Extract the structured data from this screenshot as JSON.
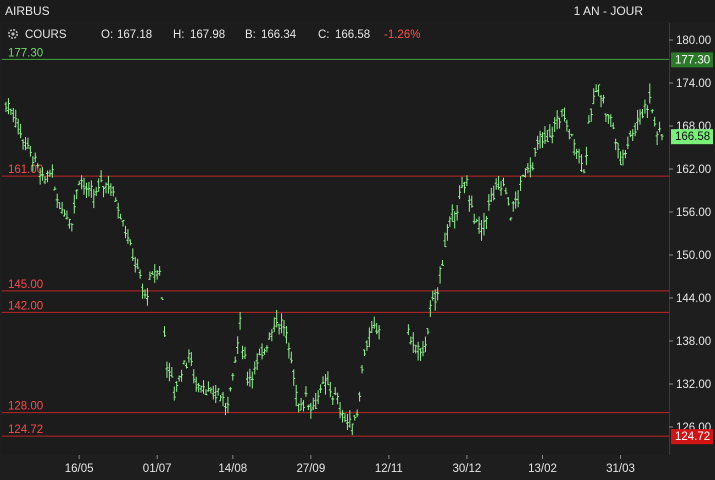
{
  "header": {
    "symbol": "AIRBUS",
    "period": "1 AN - JOUR"
  },
  "info_bar": {
    "series_label": "COURS",
    "open_label": "O:",
    "open": "167.18",
    "high_label": "H:",
    "high": "167.98",
    "low_label": "B:",
    "low": "166.34",
    "close_label": "C:",
    "close": "166.58",
    "change": "-1.26%"
  },
  "colors": {
    "background": "#1e1e1e",
    "bars": "#8ef58e",
    "green_line": "#3ea83e",
    "red_line": "#c02424",
    "red_text": "#ff4a4a",
    "last_tag": "#7af07a",
    "red_tag": "#d41414"
  },
  "chart_data": {
    "type": "ohlc",
    "ylim": [
      122,
      182
    ],
    "y_ticks": [
      180,
      174,
      168,
      162,
      156,
      150,
      144,
      138,
      132,
      126
    ],
    "y_tick_labels": [
      "180.00",
      "174.00",
      "168.00",
      "162.00",
      "156.00",
      "150.00",
      "144.00",
      "138.00",
      "132.00",
      "126.00"
    ],
    "x_tick_labels": [
      "16/05",
      "01/07",
      "14/08",
      "27/09",
      "12/11",
      "30/12",
      "13/02",
      "31/03"
    ],
    "x_tick_positions": [
      30,
      62,
      93,
      125,
      157,
      189,
      220,
      252
    ],
    "n_sessions": 270,
    "last_price": "166.58",
    "levels": [
      {
        "value": 177.3,
        "label": "177.30",
        "kind": "green"
      },
      {
        "value": 161.0,
        "label": "161.00",
        "kind": "red"
      },
      {
        "value": 145.0,
        "label": "145.00",
        "kind": "red"
      },
      {
        "value": 142.0,
        "label": "142.00",
        "kind": "red"
      },
      {
        "value": 128.0,
        "label": "128.00",
        "kind": "red"
      },
      {
        "value": 124.72,
        "label": "124.72",
        "kind": "red"
      }
    ],
    "axis_tags": [
      {
        "value": 177.3,
        "label": "177.30",
        "kind": "green"
      },
      {
        "value": 166.58,
        "label": "166.58",
        "kind": "last"
      },
      {
        "value": 124.72,
        "label": "124.72",
        "kind": "red"
      }
    ],
    "closes": [
      [
        0,
        171
      ],
      [
        3,
        170
      ],
      [
        6,
        167
      ],
      [
        9,
        165
      ],
      [
        12,
        163
      ],
      [
        15,
        160
      ],
      [
        18,
        162
      ],
      [
        21,
        158
      ],
      [
        24,
        156
      ],
      [
        27,
        155
      ],
      [
        30,
        161
      ],
      [
        33,
        159
      ],
      [
        36,
        158
      ],
      [
        39,
        160
      ],
      [
        42,
        160
      ],
      [
        45,
        158
      ],
      [
        48,
        155
      ],
      [
        51,
        151
      ],
      [
        54,
        148
      ],
      [
        57,
        144
      ],
      [
        60,
        147
      ],
      [
        63,
        148
      ],
      [
        66,
        135
      ],
      [
        69,
        131
      ],
      [
        72,
        134
      ],
      [
        75,
        136
      ],
      [
        78,
        132
      ],
      [
        81,
        132
      ],
      [
        84,
        130
      ],
      [
        87,
        131
      ],
      [
        90,
        129
      ],
      [
        93,
        133
      ],
      [
        96,
        140
      ],
      [
        99,
        133
      ],
      [
        102,
        134
      ],
      [
        105,
        136
      ],
      [
        108,
        139
      ],
      [
        111,
        141
      ],
      [
        114,
        140
      ],
      [
        117,
        135
      ],
      [
        120,
        129
      ],
      [
        123,
        130
      ],
      [
        126,
        129
      ],
      [
        129,
        131
      ],
      [
        132,
        132
      ],
      [
        135,
        130
      ],
      [
        138,
        128
      ],
      [
        141,
        126
      ],
      [
        144,
        128
      ],
      [
        147,
        137
      ],
      [
        150,
        139
      ],
      [
        153,
        140
      ],
      [
        156,
        141
      ],
      [
        159,
        143
      ],
      [
        162,
        140
      ],
      [
        165,
        139
      ],
      [
        168,
        137
      ],
      [
        171,
        136
      ],
      [
        174,
        142
      ],
      [
        177,
        145
      ],
      [
        180,
        152
      ],
      [
        183,
        155
      ],
      [
        186,
        158
      ],
      [
        189,
        160
      ],
      [
        192,
        155
      ],
      [
        195,
        153
      ],
      [
        198,
        157
      ],
      [
        201,
        159
      ],
      [
        204,
        160
      ],
      [
        207,
        156
      ],
      [
        210,
        158
      ],
      [
        213,
        162
      ],
      [
        216,
        163
      ],
      [
        219,
        166
      ],
      [
        222,
        166
      ],
      [
        225,
        168
      ],
      [
        228,
        170
      ],
      [
        231,
        167
      ],
      [
        234,
        165
      ],
      [
        237,
        162
      ],
      [
        240,
        170
      ],
      [
        243,
        174
      ],
      [
        246,
        170
      ],
      [
        249,
        168
      ],
      [
        252,
        163
      ],
      [
        255,
        166
      ],
      [
        258,
        168
      ],
      [
        261,
        170
      ],
      [
        264,
        172
      ],
      [
        267,
        167
      ],
      [
        269,
        166.58
      ]
    ],
    "gaps": [
      [
        154,
        164
      ]
    ]
  }
}
